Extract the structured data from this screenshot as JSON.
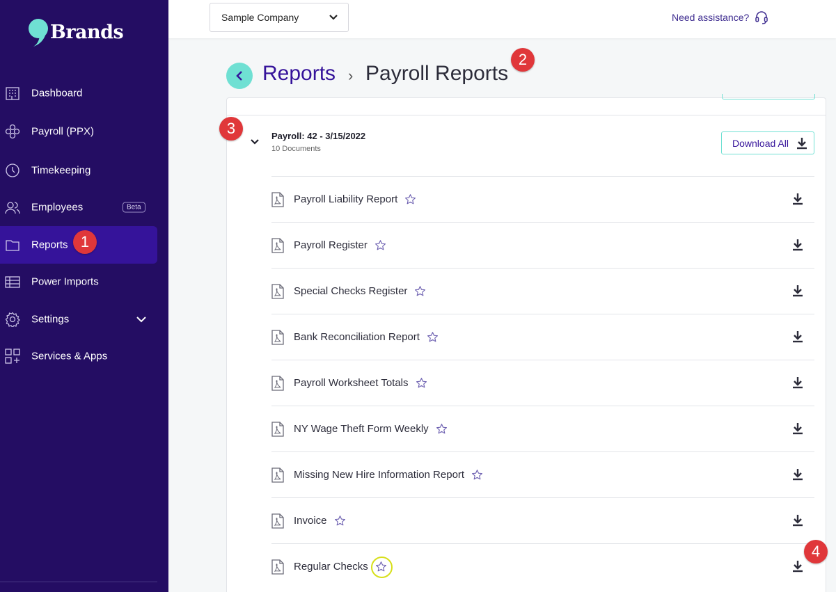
{
  "sidebar": {
    "logo_text": "Brands",
    "items": [
      {
        "label": "Dashboard",
        "icon": "building-icon"
      },
      {
        "label": "Payroll (PPX)",
        "icon": "payroll-icon"
      },
      {
        "label": "Timekeeping",
        "icon": "clock-icon"
      },
      {
        "label": "Employees",
        "icon": "users-icon",
        "badge": "Beta"
      },
      {
        "label": "Reports",
        "icon": "folder-icon",
        "active": true
      },
      {
        "label": "Power Imports",
        "icon": "table-icon"
      },
      {
        "label": "Settings",
        "icon": "gear-icon"
      },
      {
        "label": "Services & Apps",
        "icon": "grid-plus-icon"
      }
    ]
  },
  "topbar": {
    "company": "Sample Company",
    "assistance": "Need assistance?"
  },
  "header": {
    "root": "Reports",
    "separator": "›",
    "current": "Payroll Reports"
  },
  "annotations": [
    "1",
    "2",
    "3",
    "4"
  ],
  "group": {
    "title": "Payroll: 42 - 3/15/2022",
    "subtitle": "10 Documents",
    "download_all": "Download All"
  },
  "documents": [
    "Payroll Liability Report",
    "Payroll Register",
    "Special Checks Register",
    "Bank Reconciliation Report",
    "Payroll Worksheet Totals",
    "NY Wage Theft Form Weekly",
    "Missing New Hire Information Report",
    "Invoice",
    "Regular Checks"
  ],
  "colors": {
    "sidebar_bg": "#240d63",
    "active_bg": "#35139a",
    "accent_teal": "#6fe0d3",
    "badge_red": "#e0373a",
    "highlight_yellow": "#d7df1a"
  }
}
